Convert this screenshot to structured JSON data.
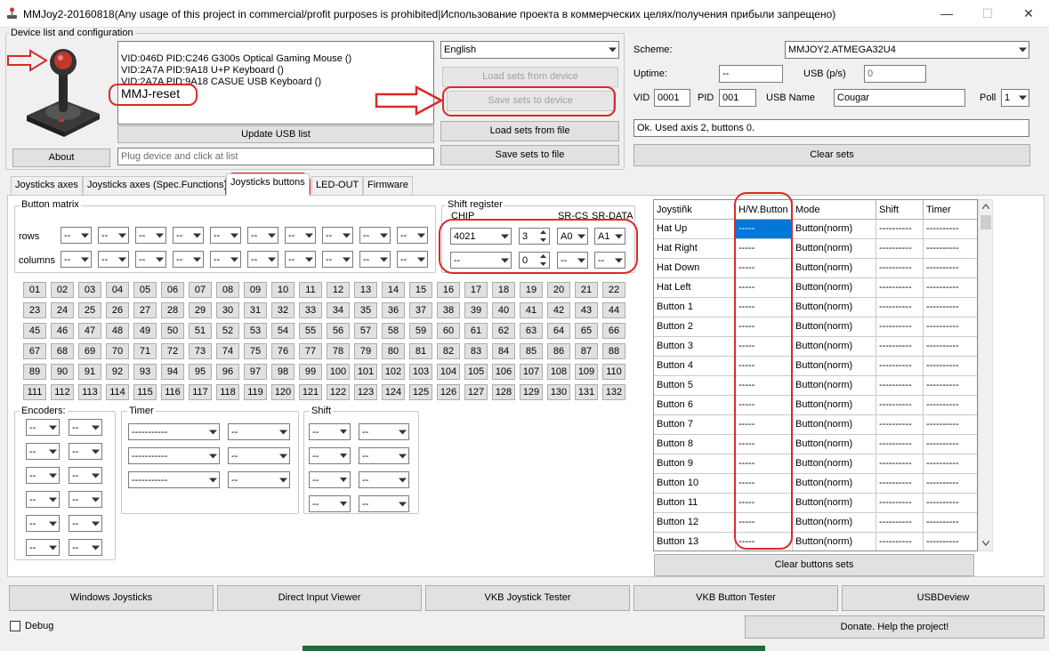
{
  "window": {
    "title": "MMJoy2-20160818(Any usage of this project in commercial/profit purposes is prohibited|Использование проекта в коммерческих целях/получения прибыли запрещено)",
    "minimize": "—",
    "maximize": "☐",
    "close": "✕"
  },
  "device_group": {
    "label": "Device list and configuration",
    "devices": [
      "VID:046D PID:C246 G300s Optical Gaming Mouse ()",
      "VID:2A7A PID:9A18 U+P Keyboard ()",
      "VID:2A7A PID:9A18 CASUE USB Keyboard ()"
    ],
    "reset_item": "MMJ-reset",
    "about": "About",
    "update_usb": "Update USB list",
    "status_placeholder": "Plug device and click at list"
  },
  "language": {
    "selected": "English"
  },
  "sets_buttons": {
    "load_device": "Load sets from device",
    "save_device": "Save sets to device",
    "load_file": "Load sets from file",
    "save_file": "Save sets to file"
  },
  "config": {
    "scheme_label": "Scheme:",
    "scheme_value": "MMJOY2.ATMEGA32U4",
    "uptime_label": "Uptime:",
    "uptime_value": "--",
    "usb_ps_label": "USB (p/s)",
    "usb_ps_value": "0",
    "vid_label": "VID",
    "vid_value": "0001",
    "pid_label": "PID",
    "pid_value": "001",
    "usb_name_label": "USB Name",
    "usb_name_value": "Cougar",
    "poll_label": "Poll",
    "poll_value": "1",
    "status": "Ok. Used axis  2, buttons 0.",
    "clear_sets": "Clear sets"
  },
  "tabs": [
    {
      "label": "Joysticks axes"
    },
    {
      "label": "Joysticks axes (Spec.Functions)"
    },
    {
      "label": "Joysticks buttons"
    },
    {
      "label": "LED-OUT"
    },
    {
      "label": "Firmware"
    }
  ],
  "button_matrix": {
    "label": "Button matrix",
    "rows_label": "rows",
    "columns_label": "columns",
    "empty_value": "--"
  },
  "shift_register": {
    "label": "Shift register",
    "chip_label": "CHIP",
    "srcs_label": "SR-CS",
    "srdata_label": "SR-DATA",
    "row1": {
      "chip": "4021",
      "count": "3",
      "cs": "A0",
      "data": "A1"
    },
    "row2": {
      "chip": "--",
      "count": "0",
      "cs": "--",
      "data": "--"
    }
  },
  "number_buttons": [
    "01",
    "02",
    "03",
    "04",
    "05",
    "06",
    "07",
    "08",
    "09",
    "10",
    "11",
    "12",
    "13",
    "14",
    "15",
    "16",
    "17",
    "18",
    "19",
    "20",
    "21",
    "22",
    "23",
    "24",
    "25",
    "26",
    "27",
    "28",
    "29",
    "30",
    "31",
    "32",
    "33",
    "34",
    "35",
    "36",
    "37",
    "38",
    "39",
    "40",
    "41",
    "42",
    "43",
    "44",
    "45",
    "46",
    "47",
    "48",
    "49",
    "50",
    "51",
    "52",
    "53",
    "54",
    "55",
    "56",
    "57",
    "58",
    "59",
    "60",
    "61",
    "62",
    "63",
    "64",
    "65",
    "66",
    "67",
    "68",
    "69",
    "70",
    "71",
    "72",
    "73",
    "74",
    "75",
    "76",
    "77",
    "78",
    "79",
    "80",
    "81",
    "82",
    "83",
    "84",
    "85",
    "86",
    "87",
    "88",
    "89",
    "90",
    "91",
    "92",
    "93",
    "94",
    "95",
    "96",
    "97",
    "98",
    "99",
    "100",
    "101",
    "102",
    "103",
    "104",
    "105",
    "106",
    "107",
    "108",
    "109",
    "110",
    "111",
    "112",
    "113",
    "114",
    "115",
    "116",
    "117",
    "118",
    "119",
    "120",
    "121",
    "122",
    "123",
    "124",
    "125",
    "126",
    "127",
    "128",
    "129",
    "130",
    "131",
    "132"
  ],
  "encoders": {
    "label": "Encoders:",
    "value": "--"
  },
  "timer": {
    "label": "Timer",
    "left_value": "-----------",
    "right_value": "--"
  },
  "shift": {
    "label": "Shift",
    "value": "--"
  },
  "grid": {
    "headers": [
      "Joystiñk",
      "H/W.Button",
      "Mode",
      "Shift",
      "Timer"
    ],
    "rows": [
      {
        "name": "Hat Up",
        "hw": "-----",
        "mode": "Button(norm)",
        "shift": "----------",
        "timer": "----------"
      },
      {
        "name": "Hat Right",
        "hw": "-----",
        "mode": "Button(norm)",
        "shift": "----------",
        "timer": "----------"
      },
      {
        "name": "Hat Down",
        "hw": "-----",
        "mode": "Button(norm)",
        "shift": "----------",
        "timer": "----------"
      },
      {
        "name": "Hat Left",
        "hw": "-----",
        "mode": "Button(norm)",
        "shift": "----------",
        "timer": "----------"
      },
      {
        "name": "Button 1",
        "hw": "-----",
        "mode": "Button(norm)",
        "shift": "----------",
        "timer": "----------"
      },
      {
        "name": "Button 2",
        "hw": "-----",
        "mode": "Button(norm)",
        "shift": "----------",
        "timer": "----------"
      },
      {
        "name": "Button 3",
        "hw": "-----",
        "mode": "Button(norm)",
        "shift": "----------",
        "timer": "----------"
      },
      {
        "name": "Button 4",
        "hw": "-----",
        "mode": "Button(norm)",
        "shift": "----------",
        "timer": "----------"
      },
      {
        "name": "Button 5",
        "hw": "-----",
        "mode": "Button(norm)",
        "shift": "----------",
        "timer": "----------"
      },
      {
        "name": "Button 6",
        "hw": "-----",
        "mode": "Button(norm)",
        "shift": "----------",
        "timer": "----------"
      },
      {
        "name": "Button 7",
        "hw": "-----",
        "mode": "Button(norm)",
        "shift": "----------",
        "timer": "----------"
      },
      {
        "name": "Button 8",
        "hw": "-----",
        "mode": "Button(norm)",
        "shift": "----------",
        "timer": "----------"
      },
      {
        "name": "Button 9",
        "hw": "-----",
        "mode": "Button(norm)",
        "shift": "----------",
        "timer": "----------"
      },
      {
        "name": "Button 10",
        "hw": "-----",
        "mode": "Button(norm)",
        "shift": "----------",
        "timer": "----------"
      },
      {
        "name": "Button 11",
        "hw": "-----",
        "mode": "Button(norm)",
        "shift": "----------",
        "timer": "----------"
      },
      {
        "name": "Button 12",
        "hw": "-----",
        "mode": "Button(norm)",
        "shift": "----------",
        "timer": "----------"
      },
      {
        "name": "Button 13",
        "hw": "-----",
        "mode": "Button(norm)",
        "shift": "----------",
        "timer": "----------"
      }
    ],
    "clear_buttons": "Clear buttons sets"
  },
  "bottom": {
    "windows_joysticks": "Windows Joysticks",
    "direct_input": "Direct Input Viewer",
    "vkb_joystick": "VKB Joystick Tester",
    "vkb_button": "VKB Button Tester",
    "usbdeview": "USBDeview",
    "debug": "Debug",
    "donate": "Donate. Help the project!"
  },
  "colors": {
    "selection": "#0078d7",
    "annotation": "#d92a2a",
    "window_bg": "#f0f0f0"
  }
}
